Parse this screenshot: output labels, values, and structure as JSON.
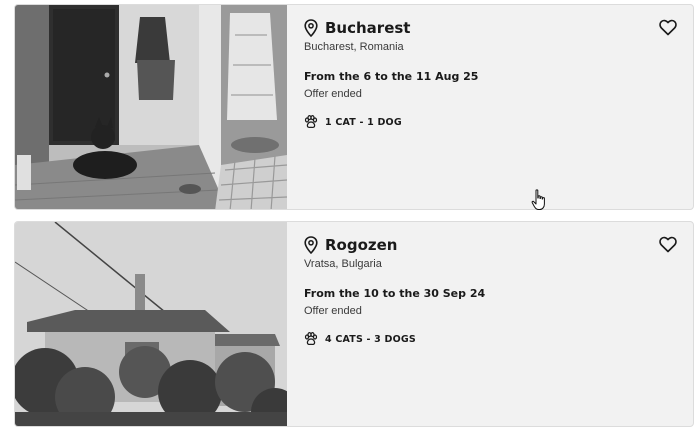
{
  "listings": [
    {
      "city": "Bucharest",
      "region": "Bucharest, Romania",
      "dates": "From the 6 to the 11 Aug 25",
      "status": "Offer ended",
      "pets": "1 CAT - 1 DOG",
      "photo_icon": "hallway-dog-photo"
    },
    {
      "city": "Rogozen",
      "region": "Vratsa, Bulgaria",
      "dates": "From the 10 to the 30 Sep 24",
      "status": "Offer ended",
      "pets": "4 CATS - 3 DOGS",
      "photo_icon": "house-garden-photo"
    }
  ],
  "icons": {
    "location": "location-pin-icon",
    "favorite": "heart-icon",
    "pets": "paw-icon",
    "cursor": "hand-pointer-cursor"
  }
}
